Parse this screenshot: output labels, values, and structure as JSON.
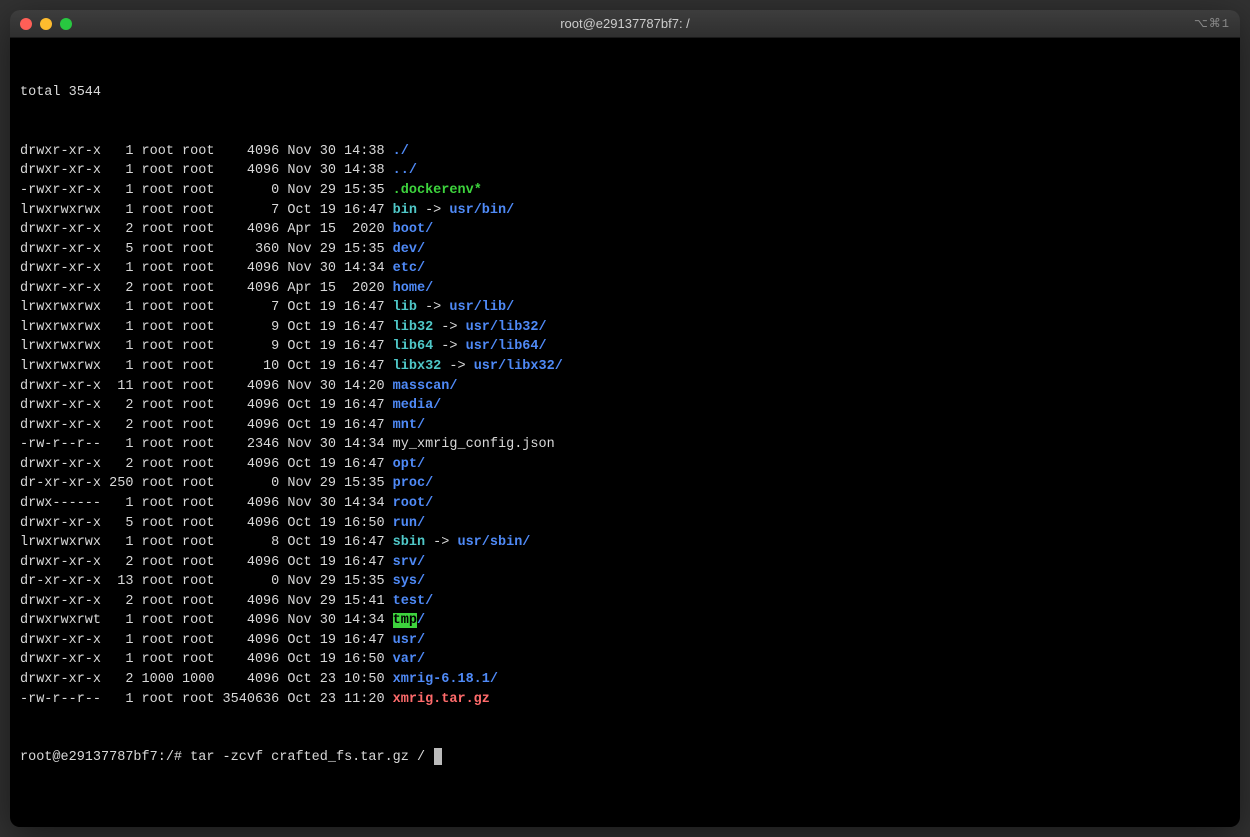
{
  "window": {
    "title": "root@e29137787bf7: /",
    "icons_text": "⌥⌘1"
  },
  "listing": {
    "total_line": "total 3544",
    "entries": [
      {
        "perm": "drwxr-xr-x",
        "links": "  1",
        "user": "root",
        "group": "root",
        "size": "   4096",
        "date": "Nov 30 14:38",
        "name": "./",
        "class": "blue"
      },
      {
        "perm": "drwxr-xr-x",
        "links": "  1",
        "user": "root",
        "group": "root",
        "size": "   4096",
        "date": "Nov 30 14:38",
        "name": "../",
        "class": "blue"
      },
      {
        "perm": "-rwxr-xr-x",
        "links": "  1",
        "user": "root",
        "group": "root",
        "size": "      0",
        "date": "Nov 29 15:35",
        "name": ".dockerenv",
        "suffix": "*",
        "class": "green"
      },
      {
        "perm": "lrwxrwxrwx",
        "links": "  1",
        "user": "root",
        "group": "root",
        "size": "      7",
        "date": "Oct 19 16:47",
        "name": "bin",
        "arrow": " -> ",
        "target": "usr/bin/",
        "class": "cyan",
        "tclass": "blue"
      },
      {
        "perm": "drwxr-xr-x",
        "links": "  2",
        "user": "root",
        "group": "root",
        "size": "   4096",
        "date": "Apr 15  2020",
        "name": "boot/",
        "class": "blue"
      },
      {
        "perm": "drwxr-xr-x",
        "links": "  5",
        "user": "root",
        "group": "root",
        "size": "    360",
        "date": "Nov 29 15:35",
        "name": "dev/",
        "class": "blue"
      },
      {
        "perm": "drwxr-xr-x",
        "links": "  1",
        "user": "root",
        "group": "root",
        "size": "   4096",
        "date": "Nov 30 14:34",
        "name": "etc/",
        "class": "blue"
      },
      {
        "perm": "drwxr-xr-x",
        "links": "  2",
        "user": "root",
        "group": "root",
        "size": "   4096",
        "date": "Apr 15  2020",
        "name": "home/",
        "class": "blue"
      },
      {
        "perm": "lrwxrwxrwx",
        "links": "  1",
        "user": "root",
        "group": "root",
        "size": "      7",
        "date": "Oct 19 16:47",
        "name": "lib",
        "arrow": " -> ",
        "target": "usr/lib/",
        "class": "cyan",
        "tclass": "blue"
      },
      {
        "perm": "lrwxrwxrwx",
        "links": "  1",
        "user": "root",
        "group": "root",
        "size": "      9",
        "date": "Oct 19 16:47",
        "name": "lib32",
        "arrow": " -> ",
        "target": "usr/lib32/",
        "class": "cyan",
        "tclass": "blue"
      },
      {
        "perm": "lrwxrwxrwx",
        "links": "  1",
        "user": "root",
        "group": "root",
        "size": "      9",
        "date": "Oct 19 16:47",
        "name": "lib64",
        "arrow": " -> ",
        "target": "usr/lib64/",
        "class": "cyan",
        "tclass": "blue"
      },
      {
        "perm": "lrwxrwxrwx",
        "links": "  1",
        "user": "root",
        "group": "root",
        "size": "     10",
        "date": "Oct 19 16:47",
        "name": "libx32",
        "arrow": " -> ",
        "target": "usr/libx32/",
        "class": "cyan",
        "tclass": "blue"
      },
      {
        "perm": "drwxr-xr-x",
        "links": " 11",
        "user": "root",
        "group": "root",
        "size": "   4096",
        "date": "Nov 30 14:20",
        "name": "masscan/",
        "class": "blue"
      },
      {
        "perm": "drwxr-xr-x",
        "links": "  2",
        "user": "root",
        "group": "root",
        "size": "   4096",
        "date": "Oct 19 16:47",
        "name": "media/",
        "class": "blue"
      },
      {
        "perm": "drwxr-xr-x",
        "links": "  2",
        "user": "root",
        "group": "root",
        "size": "   4096",
        "date": "Oct 19 16:47",
        "name": "mnt/",
        "class": "blue"
      },
      {
        "perm": "-rw-r--r--",
        "links": "  1",
        "user": "root",
        "group": "root",
        "size": "   2346",
        "date": "Nov 30 14:34",
        "name": "my_xmrig_config.json",
        "class": "white"
      },
      {
        "perm": "drwxr-xr-x",
        "links": "  2",
        "user": "root",
        "group": "root",
        "size": "   4096",
        "date": "Oct 19 16:47",
        "name": "opt/",
        "class": "blue"
      },
      {
        "perm": "dr-xr-xr-x",
        "links": "250",
        "user": "root",
        "group": "root",
        "size": "      0",
        "date": "Nov 29 15:35",
        "name": "proc/",
        "class": "blue"
      },
      {
        "perm": "drwx------",
        "links": "  1",
        "user": "root",
        "group": "root",
        "size": "   4096",
        "date": "Nov 30 14:34",
        "name": "root/",
        "class": "blue"
      },
      {
        "perm": "drwxr-xr-x",
        "links": "  5",
        "user": "root",
        "group": "root",
        "size": "   4096",
        "date": "Oct 19 16:50",
        "name": "run/",
        "class": "blue"
      },
      {
        "perm": "lrwxrwxrwx",
        "links": "  1",
        "user": "root",
        "group": "root",
        "size": "      8",
        "date": "Oct 19 16:47",
        "name": "sbin",
        "arrow": " -> ",
        "target": "usr/sbin/",
        "class": "cyan",
        "tclass": "blue"
      },
      {
        "perm": "drwxr-xr-x",
        "links": "  2",
        "user": "root",
        "group": "root",
        "size": "   4096",
        "date": "Oct 19 16:47",
        "name": "srv/",
        "class": "blue"
      },
      {
        "perm": "dr-xr-xr-x",
        "links": " 13",
        "user": "root",
        "group": "root",
        "size": "      0",
        "date": "Nov 29 15:35",
        "name": "sys/",
        "class": "blue"
      },
      {
        "perm": "drwxr-xr-x",
        "links": "  2",
        "user": "root",
        "group": "root",
        "size": "   4096",
        "date": "Nov 29 15:41",
        "name": "test/",
        "class": "blue"
      },
      {
        "perm": "drwxrwxrwt",
        "links": "  1",
        "user": "root",
        "group": "root",
        "size": "   4096",
        "date": "Nov 30 14:34",
        "name": "tmp",
        "suffix": "/",
        "class": "bg-green",
        "suffixclass": "blue"
      },
      {
        "perm": "drwxr-xr-x",
        "links": "  1",
        "user": "root",
        "group": "root",
        "size": "   4096",
        "date": "Oct 19 16:47",
        "name": "usr/",
        "class": "blue"
      },
      {
        "perm": "drwxr-xr-x",
        "links": "  1",
        "user": "root",
        "group": "root",
        "size": "   4096",
        "date": "Oct 19 16:50",
        "name": "var/",
        "class": "blue"
      },
      {
        "perm": "drwxr-xr-x",
        "links": "  2",
        "user": "1000",
        "group": "1000",
        "size": "   4096",
        "date": "Oct 23 10:50",
        "name": "xmrig-6.18.1/",
        "class": "blue"
      },
      {
        "perm": "-rw-r--r--",
        "links": "  1",
        "user": "root",
        "group": "root",
        "size": "3540636",
        "date": "Oct 23 11:20",
        "name": "xmrig.tar.gz",
        "class": "red"
      }
    ]
  },
  "prompt": {
    "text": "root@e29137787bf7:/# ",
    "command": "tar -zcvf crafted_fs.tar.gz / "
  }
}
